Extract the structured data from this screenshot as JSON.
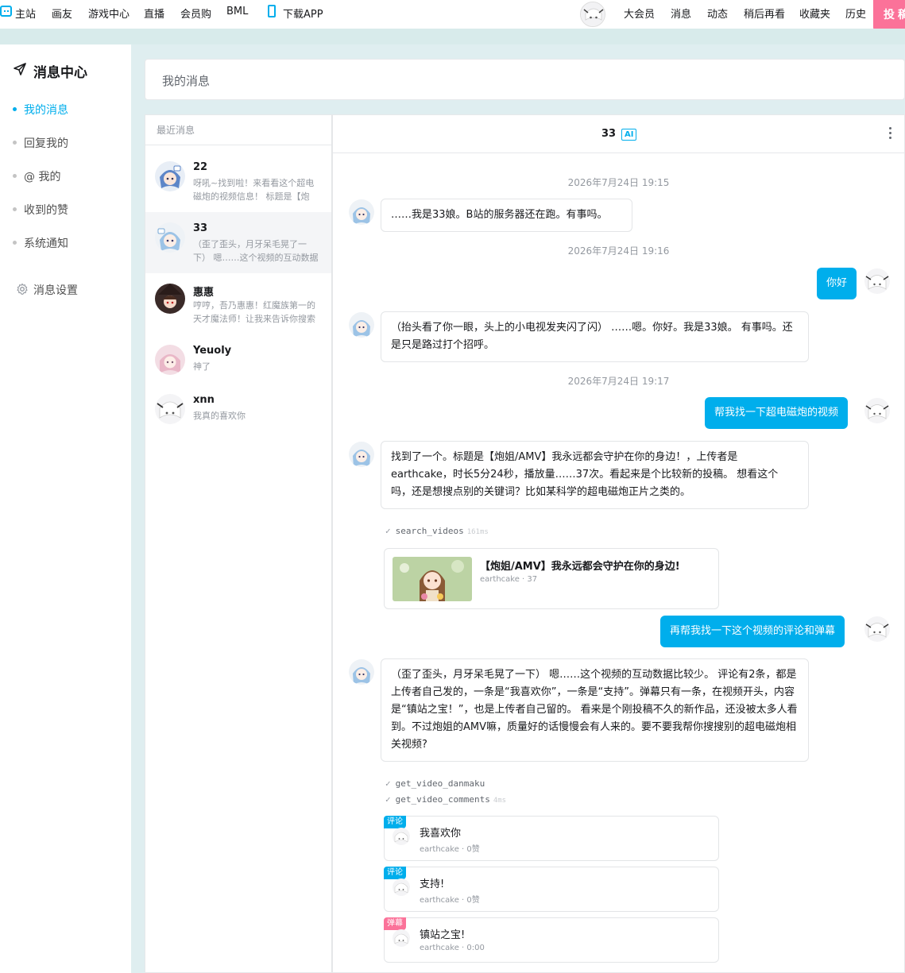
{
  "topnav": {
    "items": [
      "主站",
      "画友",
      "游戏中心",
      "直播",
      "会员购",
      "BML"
    ],
    "download": "下载APP",
    "right": [
      "大会员",
      "消息",
      "动态",
      "稍后再看",
      "收藏夹",
      "历史"
    ],
    "upload": "投稿"
  },
  "sidebar": {
    "title": "消息中心",
    "items": [
      {
        "label": "我的消息",
        "active": true
      },
      {
        "label": "回复我的",
        "active": false
      },
      {
        "label": "@ 我的",
        "active": false
      },
      {
        "label": "收到的赞",
        "active": false
      },
      {
        "label": "系统通知",
        "active": false
      }
    ],
    "settings": "消息设置"
  },
  "header": {
    "title": "我的消息"
  },
  "conversations": {
    "heading": "最近消息",
    "items": [
      {
        "name": "22",
        "preview": "呀吼~找到啦！来看看这个超电磁炮的视频信息！ 标题是【炮姐/AMV】我永远都会守护在你的身边！",
        "selected": false
      },
      {
        "name": "33",
        "preview": "（歪了歪头，月牙呆毛晃了一下） 嗯……这个视频的互动数据比较少。",
        "selected": true
      },
      {
        "name": "惠惠",
        "preview": "哼哼，吾乃惠惠！红魔族第一的天才魔法师！让我来告诉你搜索结果！",
        "selected": false
      },
      {
        "name": "Yeuoly",
        "preview": "神了",
        "selected": false
      },
      {
        "name": "xnn",
        "preview": "我真的喜欢你",
        "selected": false
      }
    ]
  },
  "chat": {
    "title": "33",
    "badge": "AI",
    "messages": {
      "ts1": "2026年7月24日 19:15",
      "m1": "……我是33娘。B站的服务器还在跑。有事吗。",
      "ts2": "2026年7月24日 19:16",
      "u1": "你好",
      "m2": "（抬头看了你一眼，头上的小电视发夹闪了闪） ……嗯。你好。我是33娘。 有事吗。还是只是路过打个招呼。",
      "ts3": "2026年7月24日 19:17",
      "u2": "帮我找一下超电磁炮的视频",
      "m3": "找到了一个。标题是【炮姐/AMV】我永远都会守护在你的身边！，上传者是earthcake，时长5分24秒，播放量……37次。看起来是个比较新的投稿。 想看这个吗，还是想搜点别的关键词？比如某科学的超电磁炮正片之类的。",
      "u3": "再帮我找一下这个视频的评论和弹幕",
      "m4": "（歪了歪头，月牙呆毛晃了一下） 嗯……这个视频的互动数据比较少。 评论有2条，都是上传者自己发的，一条是“我喜欢你”，一条是“支持”。弹幕只有一条，在视频开头，内容是“镇站之宝！”，也是上传者自己留的。 看来是个刚投稿不久的新作品，还没被太多人看到。不过炮姐的AMV嘛，质量好的话慢慢会有人来的。要不要我帮你搜搜别的超电磁炮相关视频?"
    },
    "tools": [
      {
        "name": "search_videos",
        "ms": "161ms"
      },
      {
        "name": "get_video_danmaku",
        "ms": ""
      },
      {
        "name": "get_video_comments",
        "ms": "4ms"
      }
    ],
    "video_card": {
      "title": "【炮姐/AMV】我永远都会守护在你的身边!",
      "meta": "earthcake · 37"
    },
    "comment_cards": [
      {
        "tag": "评论",
        "text": "我喜欢你",
        "meta": "earthcake · 0赞",
        "color": "#00aeec"
      },
      {
        "tag": "评论",
        "text": "支持!",
        "meta": "earthcake · 0赞",
        "color": "#00aeec"
      },
      {
        "tag": "弹幕",
        "text": "镇站之宝!",
        "meta": "earthcake · 0:00",
        "color": "#fb7299"
      }
    ]
  },
  "colors": {
    "accent": "#00aeec",
    "pink": "#fb7299"
  }
}
